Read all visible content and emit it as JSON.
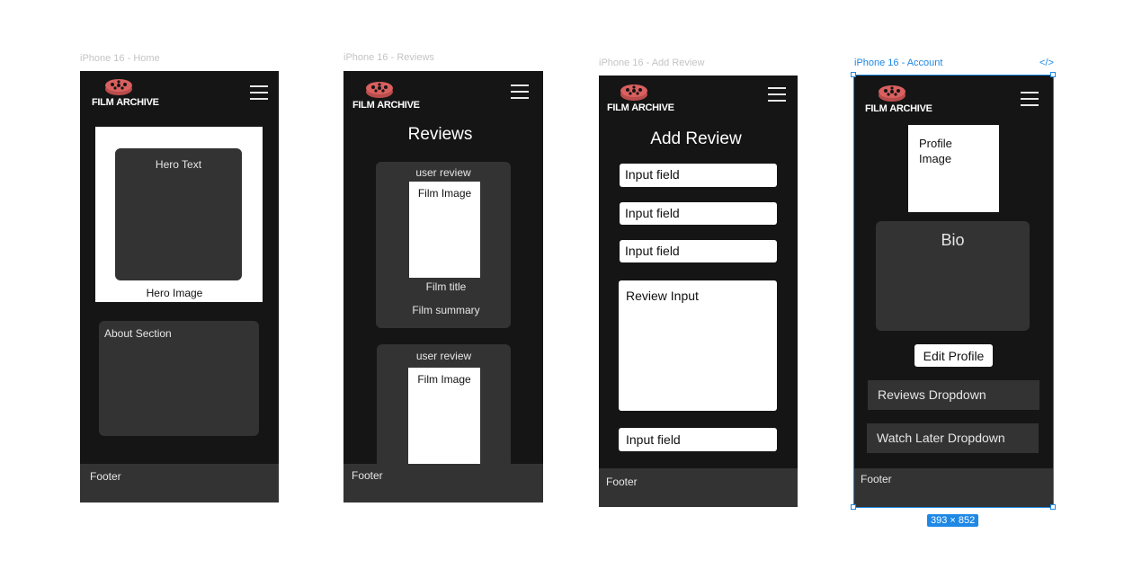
{
  "frames": {
    "home": {
      "label": "iPhone 16 - Home",
      "hero_text": "Hero Text",
      "hero_image": "Hero Image",
      "about": "About Section",
      "footer": "Footer"
    },
    "reviews": {
      "label": "iPhone 16 - Reviews",
      "title": "Reviews",
      "cards": [
        {
          "user_review": "user review",
          "film_image": "Film Image",
          "film_title": "Film title",
          "film_summary": "Film summary"
        },
        {
          "user_review": "user review",
          "film_image": "Film Image"
        }
      ],
      "footer": "Footer"
    },
    "add_review": {
      "label": "iPhone 16 - Add Review",
      "title": "Add Review",
      "inputs": [
        "Input field",
        "Input field",
        "Input field"
      ],
      "review_input": "Review Input",
      "last_input": "Input field",
      "footer": "Footer"
    },
    "account": {
      "label": "iPhone 16 - Account",
      "profile_image": "Profile Image",
      "bio": "Bio",
      "edit_profile": "Edit Profile",
      "reviews_dropdown": "Reviews Dropdown",
      "watch_later_dropdown": "Watch Later Dropdown",
      "footer": "Footer",
      "dimensions": "393 × 852",
      "code_icon_glyph": "</>"
    }
  },
  "logo": {
    "film": "FILM",
    "archive": "ARCHIVE",
    "reel_color": "#d9605f"
  },
  "colors": {
    "frame_bg": "#151515",
    "panel": "#333333",
    "selection": "#1e88e5"
  }
}
